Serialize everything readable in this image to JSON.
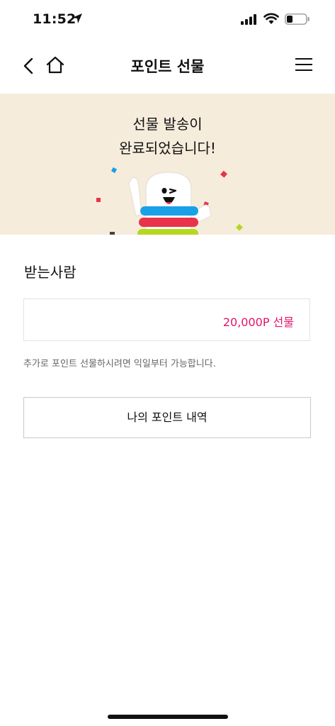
{
  "status_bar": {
    "time": "11:52"
  },
  "nav": {
    "title": "포인트 선물"
  },
  "hero": {
    "line1": "선물 발송이",
    "line2": "완료되었습니다!"
  },
  "recipient_section": {
    "title": "받는사람",
    "recipient_name": "",
    "amount_label": "20,000P 선물"
  },
  "note": "추가로 포인트 선물하시려면 익일부터 가능합니다.",
  "history_button": {
    "label": "나의 포인트 내역"
  },
  "colors": {
    "accent": "#e3146e",
    "hero_bg": "#f6ecdc"
  }
}
